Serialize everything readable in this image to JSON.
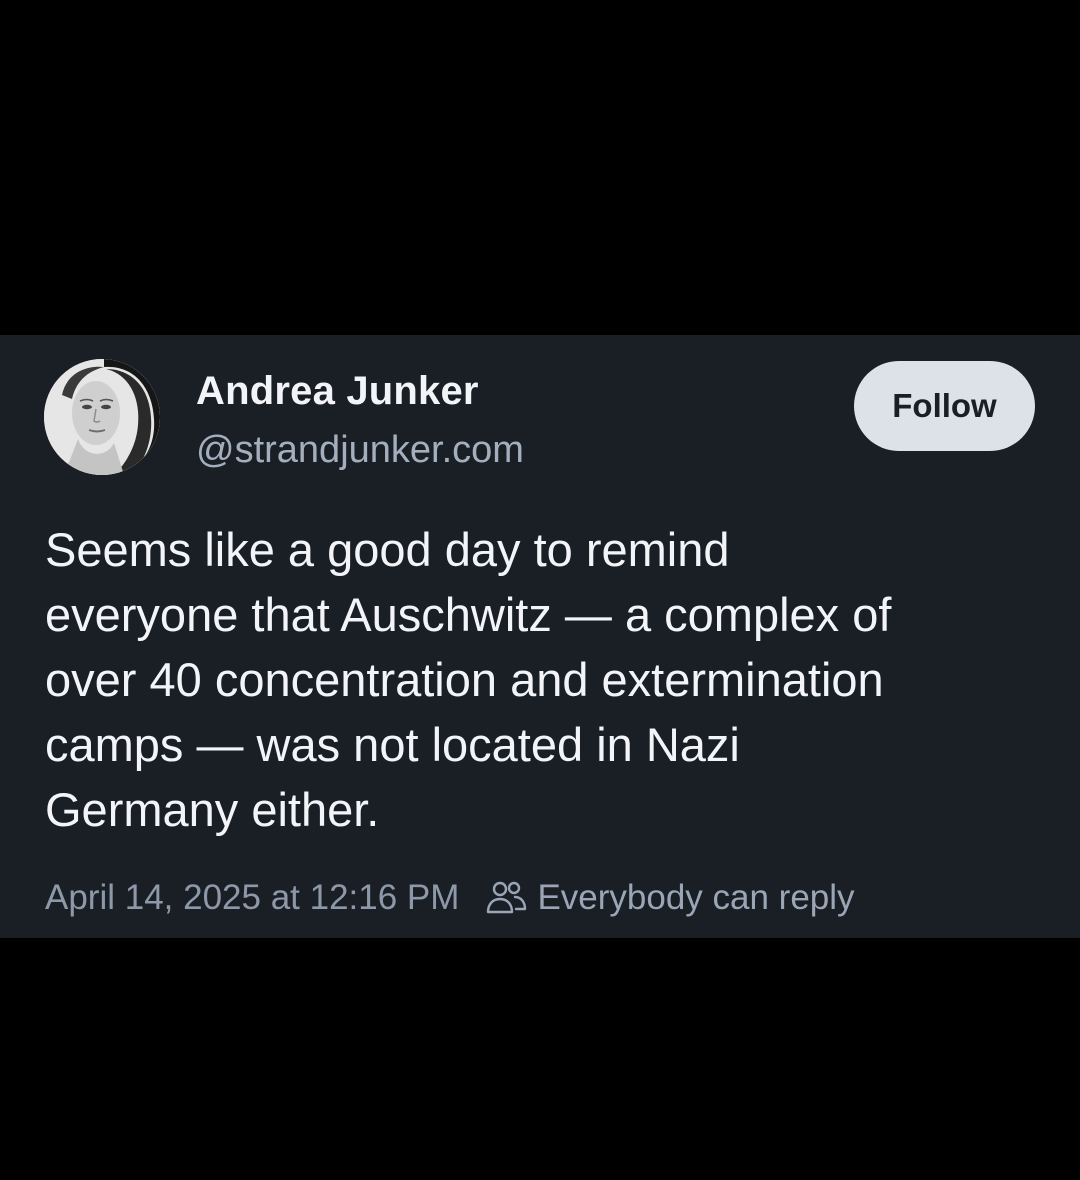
{
  "post": {
    "author": {
      "display_name": "Andrea Junker",
      "handle": "@strandjunker.com"
    },
    "follow_label": "Follow",
    "text_lines": [
      "Seems like a good day to remind",
      "everyone that Auschwitz — a complex of",
      "over 40 concentration and extermination",
      "camps — was not located in Nazi",
      "Germany either."
    ],
    "timestamp": "April 14, 2025 at 12:16 PM",
    "reply_setting": {
      "icon": "people-icon",
      "label": "Everybody can reply"
    }
  },
  "colors": {
    "page_background": "#000000",
    "card_background": "#1a1f26",
    "text_primary": "#f2f4f7",
    "text_secondary": "#a4afbd",
    "follow_button_background": "#dde2e9",
    "reply_accent": "#9aa6b6"
  }
}
